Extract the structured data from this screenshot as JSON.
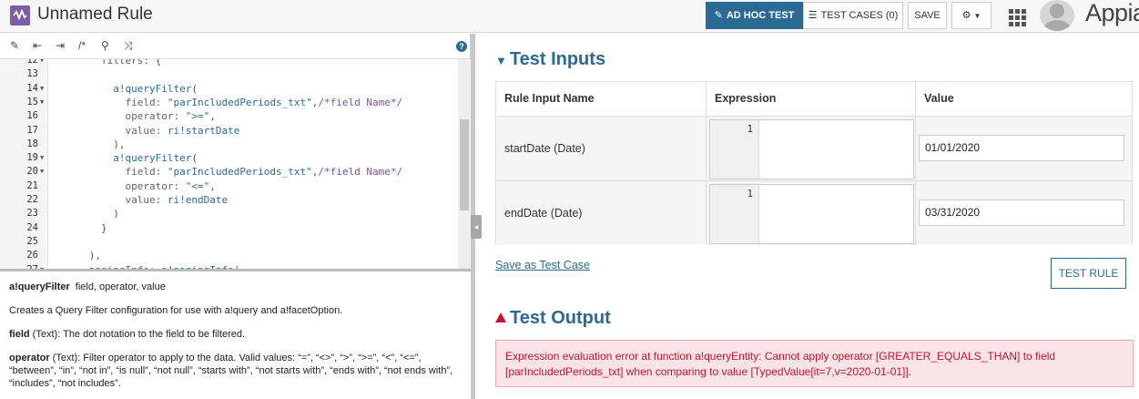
{
  "header": {
    "title": "Unnamed Rule",
    "buttons": {
      "adhoc": "AD HOC TEST",
      "testcases": "TEST CASES (0)",
      "save": "SAVE"
    },
    "brand": "Appia"
  },
  "editor": {
    "toolbar": {
      "comment_label": "/*"
    },
    "lines": [
      {
        "n": "12",
        "fold": true,
        "indent": "        ",
        "fn": "",
        "text": "filters: {"
      },
      {
        "n": "13",
        "fold": false,
        "indent": "",
        "fn": "",
        "text": ""
      },
      {
        "n": "14",
        "fold": true,
        "indent": "          ",
        "fn": "a!queryFilter",
        "text": "("
      },
      {
        "n": "15",
        "fold": true,
        "indent": "            ",
        "key": "field: ",
        "str": "\"parIncludedPeriods_txt\"",
        "rest": ",",
        "cmt": "/*field Name*/"
      },
      {
        "n": "16",
        "fold": false,
        "indent": "            ",
        "key": "operator: ",
        "str": "\">=\"",
        "rest": ",",
        "cmt": ""
      },
      {
        "n": "17",
        "fold": false,
        "indent": "            ",
        "key": "value: ",
        "str": "ri!startDate",
        "rest": "",
        "cmt": ""
      },
      {
        "n": "18",
        "fold": false,
        "indent": "          ",
        "fn": "",
        "text": "),"
      },
      {
        "n": "19",
        "fold": true,
        "indent": "          ",
        "fn": "a!queryFilter",
        "text": "("
      },
      {
        "n": "20",
        "fold": true,
        "indent": "            ",
        "key": "field: ",
        "str": "\"parIncludedPeriods_txt\"",
        "rest": ",",
        "cmt": "/*field Name*/"
      },
      {
        "n": "21",
        "fold": false,
        "indent": "            ",
        "key": "operator: ",
        "str": "\"<=\"",
        "rest": ",",
        "cmt": ""
      },
      {
        "n": "22",
        "fold": false,
        "indent": "            ",
        "key": "value: ",
        "str": "ri!endDate",
        "rest": "",
        "cmt": ""
      },
      {
        "n": "23",
        "fold": false,
        "indent": "          ",
        "fn": "",
        "text": ")"
      },
      {
        "n": "24",
        "fold": false,
        "indent": "        ",
        "fn": "",
        "text": "}"
      },
      {
        "n": "25",
        "fold": false,
        "indent": "",
        "fn": "",
        "text": ""
      },
      {
        "n": "26",
        "fold": false,
        "indent": "      ",
        "fn": "",
        "text": "),"
      },
      {
        "n": "27",
        "fold": true,
        "indent": "      ",
        "key": "pagingInfo: ",
        "str": "",
        "rest": "",
        "cmt": "",
        "fn2": "a!pagingInfo("
      }
    ]
  },
  "docs": {
    "signature_fn": "a!queryFilter",
    "signature_params": "field, operator, value",
    "description": "Creates a Query Filter configuration for use with a!query and a!facetOption.",
    "field_name": "field",
    "field_desc": " (Text): The dot notation to the field to be filtered.",
    "operator_name": "operator",
    "operator_desc": " (Text): Filter operator to apply to the data. Valid values: “=”, “<>”, “>”, “>=”, “<”, “<=”, “between”, “in”, “not in”, “is null”, “not null”, “starts with”, “not starts with”, “ends with”, “not ends with”, “includes”, “not includes”."
  },
  "test_inputs": {
    "title": "Test Inputs",
    "columns": [
      "Rule Input Name",
      "Expression",
      "Value"
    ],
    "rows": [
      {
        "name": "startDate (Date)",
        "line": "1",
        "value": "01/01/2020"
      },
      {
        "name": "endDate (Date)",
        "line": "1",
        "value": "03/31/2020"
      }
    ],
    "save_link": "Save as Test Case",
    "test_button": "TEST RULE"
  },
  "test_output": {
    "title": "Test Output",
    "error": "Expression evaluation error at function a!queryEntity: Cannot apply operator [GREATER_EQUALS_THAN] to field [parIncludedPeriods_txt] when comparing to value [TypedValue[it=7,v=2020-01-01]]."
  },
  "colors": {
    "accent": "#2b6a93",
    "error": "#c8102e",
    "error_bg": "#fbe4e7"
  }
}
